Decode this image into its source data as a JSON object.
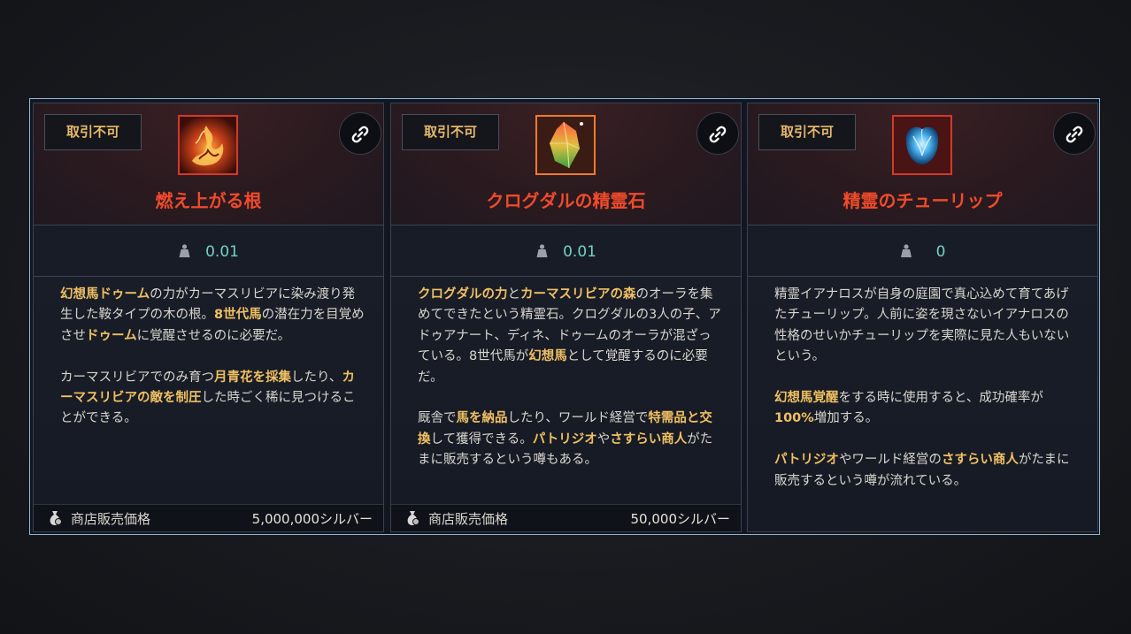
{
  "cards": [
    {
      "badge": "取引不可",
      "name": "燃え上がる根",
      "icon": "burning-root-icon",
      "weight": "0.01",
      "desc": [
        [
          {
            "t": "幻想馬ドゥーム",
            "h": true
          },
          {
            "t": "の力がカーマスリビアに染み渡り発生した鞍タイプの木の根。",
            "h": false
          },
          {
            "t": "8世代馬",
            "h": true
          },
          {
            "t": "の潜在力を目覚めさせ",
            "h": false
          },
          {
            "t": "ドゥーム",
            "h": true
          },
          {
            "t": "に覚醒させるのに必要だ。",
            "h": false
          }
        ],
        [
          {
            "t": "カーマスリビアでのみ育つ",
            "h": false
          },
          {
            "t": "月青花を採集",
            "h": true
          },
          {
            "t": "したり、",
            "h": false
          },
          {
            "t": "カーマスリビアの敵を制圧",
            "h": true
          },
          {
            "t": "した時ごく稀に見つけることができる。",
            "h": false
          }
        ]
      ],
      "price_label": "商店販売価格",
      "price_value": "5,000,000シルバー"
    },
    {
      "badge": "取引不可",
      "name": "クログダルの精霊石",
      "icon": "spirit-stone-icon",
      "weight": "0.01",
      "desc": [
        [
          {
            "t": "クログダルの力",
            "h": true
          },
          {
            "t": "と",
            "h": false
          },
          {
            "t": "カーマスリビアの森",
            "h": true
          },
          {
            "t": "のオーラを集めてできたという精霊石。クログダルの3人の子、アドゥアナート、ディネ、ドゥームのオーラが混ざっている。8世代馬が",
            "h": false
          },
          {
            "t": "幻想馬",
            "h": true
          },
          {
            "t": "として覚醒するのに必要だ。",
            "h": false
          }
        ],
        [
          {
            "t": "厩舎で",
            "h": false
          },
          {
            "t": "馬を納品",
            "h": true
          },
          {
            "t": "したり、ワールド経営で",
            "h": false
          },
          {
            "t": "特需品と交換",
            "h": true
          },
          {
            "t": "して獲得できる。",
            "h": false
          },
          {
            "t": "パトリジオ",
            "h": true
          },
          {
            "t": "や",
            "h": false
          },
          {
            "t": "さすらい商人",
            "h": true
          },
          {
            "t": "がたまに販売するという噂もある。",
            "h": false
          }
        ]
      ],
      "price_label": "商店販売価格",
      "price_value": "50,000シルバー"
    },
    {
      "badge": "取引不可",
      "name": "精霊のチューリップ",
      "icon": "spirit-tulip-icon",
      "weight": "0",
      "desc": [
        [
          {
            "t": "精霊イアナロスが自身の庭園で真心込めて育てあげたチューリップ。人前に姿を現さないイアナロスの性格のせいかチューリップを実際に見た人もいないという。",
            "h": false
          }
        ],
        [
          {
            "t": "幻想馬覚醒",
            "h": true
          },
          {
            "t": "をする時に使用すると、成功確率が",
            "h": false
          },
          {
            "t": "100%",
            "h": true
          },
          {
            "t": "増加する。",
            "h": false
          }
        ],
        [
          {
            "t": "パトリジオ",
            "h": true
          },
          {
            "t": "やワールド経営の",
            "h": false
          },
          {
            "t": "さすらい商人",
            "h": true
          },
          {
            "t": "がたまに販売するという噂が流れている。",
            "h": false
          }
        ]
      ],
      "price_label": "",
      "price_value": ""
    }
  ],
  "colors": {
    "item_name": "#f04a2a",
    "highlight": "#f0c062",
    "weight_value": "#6fd3c7",
    "badge_text": "#e7b86a",
    "frame_border": "#8fb8d8"
  }
}
